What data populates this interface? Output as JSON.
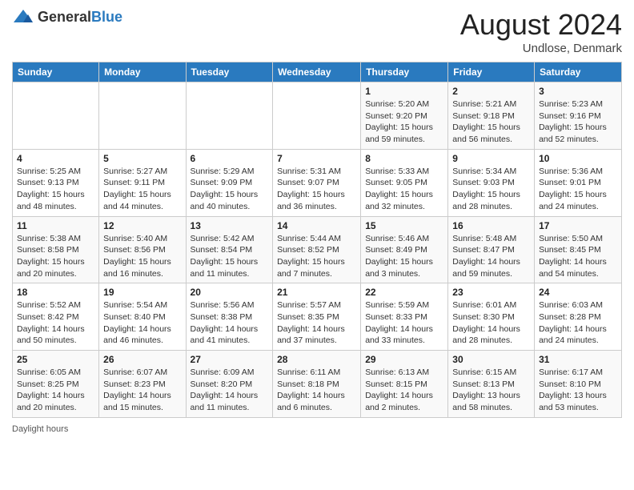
{
  "header": {
    "logo_general": "General",
    "logo_blue": "Blue",
    "month_year": "August 2024",
    "location": "Undlose, Denmark"
  },
  "footer": {
    "daylight_label": "Daylight hours"
  },
  "days_of_week": [
    "Sunday",
    "Monday",
    "Tuesday",
    "Wednesday",
    "Thursday",
    "Friday",
    "Saturday"
  ],
  "weeks": [
    [
      {
        "day": "",
        "info": ""
      },
      {
        "day": "",
        "info": ""
      },
      {
        "day": "",
        "info": ""
      },
      {
        "day": "",
        "info": ""
      },
      {
        "day": "1",
        "info": "Sunrise: 5:20 AM\nSunset: 9:20 PM\nDaylight: 15 hours\nand 59 minutes."
      },
      {
        "day": "2",
        "info": "Sunrise: 5:21 AM\nSunset: 9:18 PM\nDaylight: 15 hours\nand 56 minutes."
      },
      {
        "day": "3",
        "info": "Sunrise: 5:23 AM\nSunset: 9:16 PM\nDaylight: 15 hours\nand 52 minutes."
      }
    ],
    [
      {
        "day": "4",
        "info": "Sunrise: 5:25 AM\nSunset: 9:13 PM\nDaylight: 15 hours\nand 48 minutes."
      },
      {
        "day": "5",
        "info": "Sunrise: 5:27 AM\nSunset: 9:11 PM\nDaylight: 15 hours\nand 44 minutes."
      },
      {
        "day": "6",
        "info": "Sunrise: 5:29 AM\nSunset: 9:09 PM\nDaylight: 15 hours\nand 40 minutes."
      },
      {
        "day": "7",
        "info": "Sunrise: 5:31 AM\nSunset: 9:07 PM\nDaylight: 15 hours\nand 36 minutes."
      },
      {
        "day": "8",
        "info": "Sunrise: 5:33 AM\nSunset: 9:05 PM\nDaylight: 15 hours\nand 32 minutes."
      },
      {
        "day": "9",
        "info": "Sunrise: 5:34 AM\nSunset: 9:03 PM\nDaylight: 15 hours\nand 28 minutes."
      },
      {
        "day": "10",
        "info": "Sunrise: 5:36 AM\nSunset: 9:01 PM\nDaylight: 15 hours\nand 24 minutes."
      }
    ],
    [
      {
        "day": "11",
        "info": "Sunrise: 5:38 AM\nSunset: 8:58 PM\nDaylight: 15 hours\nand 20 minutes."
      },
      {
        "day": "12",
        "info": "Sunrise: 5:40 AM\nSunset: 8:56 PM\nDaylight: 15 hours\nand 16 minutes."
      },
      {
        "day": "13",
        "info": "Sunrise: 5:42 AM\nSunset: 8:54 PM\nDaylight: 15 hours\nand 11 minutes."
      },
      {
        "day": "14",
        "info": "Sunrise: 5:44 AM\nSunset: 8:52 PM\nDaylight: 15 hours\nand 7 minutes."
      },
      {
        "day": "15",
        "info": "Sunrise: 5:46 AM\nSunset: 8:49 PM\nDaylight: 15 hours\nand 3 minutes."
      },
      {
        "day": "16",
        "info": "Sunrise: 5:48 AM\nSunset: 8:47 PM\nDaylight: 14 hours\nand 59 minutes."
      },
      {
        "day": "17",
        "info": "Sunrise: 5:50 AM\nSunset: 8:45 PM\nDaylight: 14 hours\nand 54 minutes."
      }
    ],
    [
      {
        "day": "18",
        "info": "Sunrise: 5:52 AM\nSunset: 8:42 PM\nDaylight: 14 hours\nand 50 minutes."
      },
      {
        "day": "19",
        "info": "Sunrise: 5:54 AM\nSunset: 8:40 PM\nDaylight: 14 hours\nand 46 minutes."
      },
      {
        "day": "20",
        "info": "Sunrise: 5:56 AM\nSunset: 8:38 PM\nDaylight: 14 hours\nand 41 minutes."
      },
      {
        "day": "21",
        "info": "Sunrise: 5:57 AM\nSunset: 8:35 PM\nDaylight: 14 hours\nand 37 minutes."
      },
      {
        "day": "22",
        "info": "Sunrise: 5:59 AM\nSunset: 8:33 PM\nDaylight: 14 hours\nand 33 minutes."
      },
      {
        "day": "23",
        "info": "Sunrise: 6:01 AM\nSunset: 8:30 PM\nDaylight: 14 hours\nand 28 minutes."
      },
      {
        "day": "24",
        "info": "Sunrise: 6:03 AM\nSunset: 8:28 PM\nDaylight: 14 hours\nand 24 minutes."
      }
    ],
    [
      {
        "day": "25",
        "info": "Sunrise: 6:05 AM\nSunset: 8:25 PM\nDaylight: 14 hours\nand 20 minutes."
      },
      {
        "day": "26",
        "info": "Sunrise: 6:07 AM\nSunset: 8:23 PM\nDaylight: 14 hours\nand 15 minutes."
      },
      {
        "day": "27",
        "info": "Sunrise: 6:09 AM\nSunset: 8:20 PM\nDaylight: 14 hours\nand 11 minutes."
      },
      {
        "day": "28",
        "info": "Sunrise: 6:11 AM\nSunset: 8:18 PM\nDaylight: 14 hours\nand 6 minutes."
      },
      {
        "day": "29",
        "info": "Sunrise: 6:13 AM\nSunset: 8:15 PM\nDaylight: 14 hours\nand 2 minutes."
      },
      {
        "day": "30",
        "info": "Sunrise: 6:15 AM\nSunset: 8:13 PM\nDaylight: 13 hours\nand 58 minutes."
      },
      {
        "day": "31",
        "info": "Sunrise: 6:17 AM\nSunset: 8:10 PM\nDaylight: 13 hours\nand 53 minutes."
      }
    ]
  ]
}
